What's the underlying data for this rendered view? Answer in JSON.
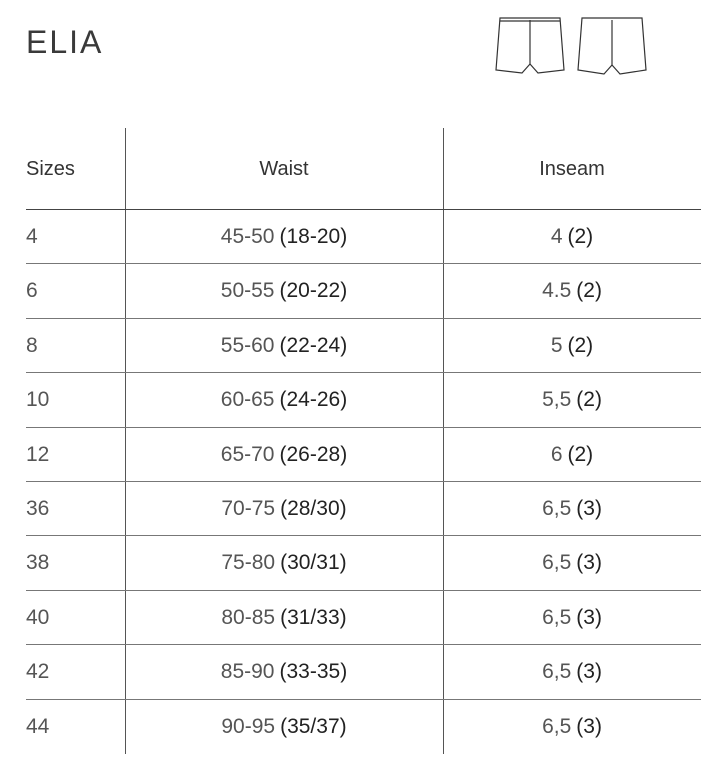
{
  "title": "ELIA",
  "icons": [
    "shorts-front-icon",
    "shorts-back-icon"
  ],
  "table": {
    "headers": [
      "Sizes",
      "Waist",
      "Inseam"
    ],
    "rows": [
      {
        "size": "4",
        "waist": "45-50",
        "waist_in": "(18-20)",
        "inseam": "4",
        "inseam_in": "(2)"
      },
      {
        "size": "6",
        "waist": "50-55",
        "waist_in": "(20-22)",
        "inseam": "4.5",
        "inseam_in": "(2)"
      },
      {
        "size": "8",
        "waist": "55-60",
        "waist_in": "(22-24)",
        "inseam": "5",
        "inseam_in": "(2)"
      },
      {
        "size": "10",
        "waist": "60-65",
        "waist_in": "(24-26)",
        "inseam": "5,5",
        "inseam_in": "(2)"
      },
      {
        "size": "12",
        "waist": "65-70",
        "waist_in": "(26-28)",
        "inseam": "6",
        "inseam_in": "(2)"
      },
      {
        "size": "36",
        "waist": "70-75",
        "waist_in": "(28/30)",
        "inseam": "6,5",
        "inseam_in": "(3)"
      },
      {
        "size": "38",
        "waist": "75-80",
        "waist_in": "(30/31)",
        "inseam": "6,5",
        "inseam_in": "(3)"
      },
      {
        "size": "40",
        "waist": "80-85",
        "waist_in": "(31/33)",
        "inseam": "6,5",
        "inseam_in": "(3)"
      },
      {
        "size": "42",
        "waist": "85-90",
        "waist_in": "(33-35)",
        "inseam": "6,5",
        "inseam_in": "(3)"
      },
      {
        "size": "44",
        "waist": "90-95",
        "waist_in": "(35/37)",
        "inseam": "6,5",
        "inseam_in": "(3)"
      }
    ]
  }
}
